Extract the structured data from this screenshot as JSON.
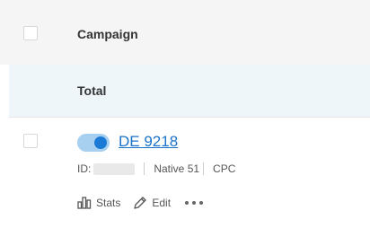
{
  "table": {
    "header": {
      "campaign_col": "Campaign"
    },
    "total_row": {
      "label": "Total"
    },
    "rows": [
      {
        "name": "DE 9218",
        "active": true,
        "id_label": "ID:",
        "source": "Native 51",
        "pricing": "CPC",
        "actions": {
          "stats": "Stats",
          "edit": "Edit"
        }
      }
    ]
  },
  "icons": {
    "stats": "bar-chart-icon",
    "edit": "pencil-icon",
    "more": "ellipsis-icon"
  },
  "colors": {
    "link": "#1a73c8",
    "toggle_on_track": "#a6cff0",
    "toggle_on_knob": "#1a7ad6",
    "header_bg": "#f5f5f5",
    "total_bg": "#eef6fa"
  }
}
